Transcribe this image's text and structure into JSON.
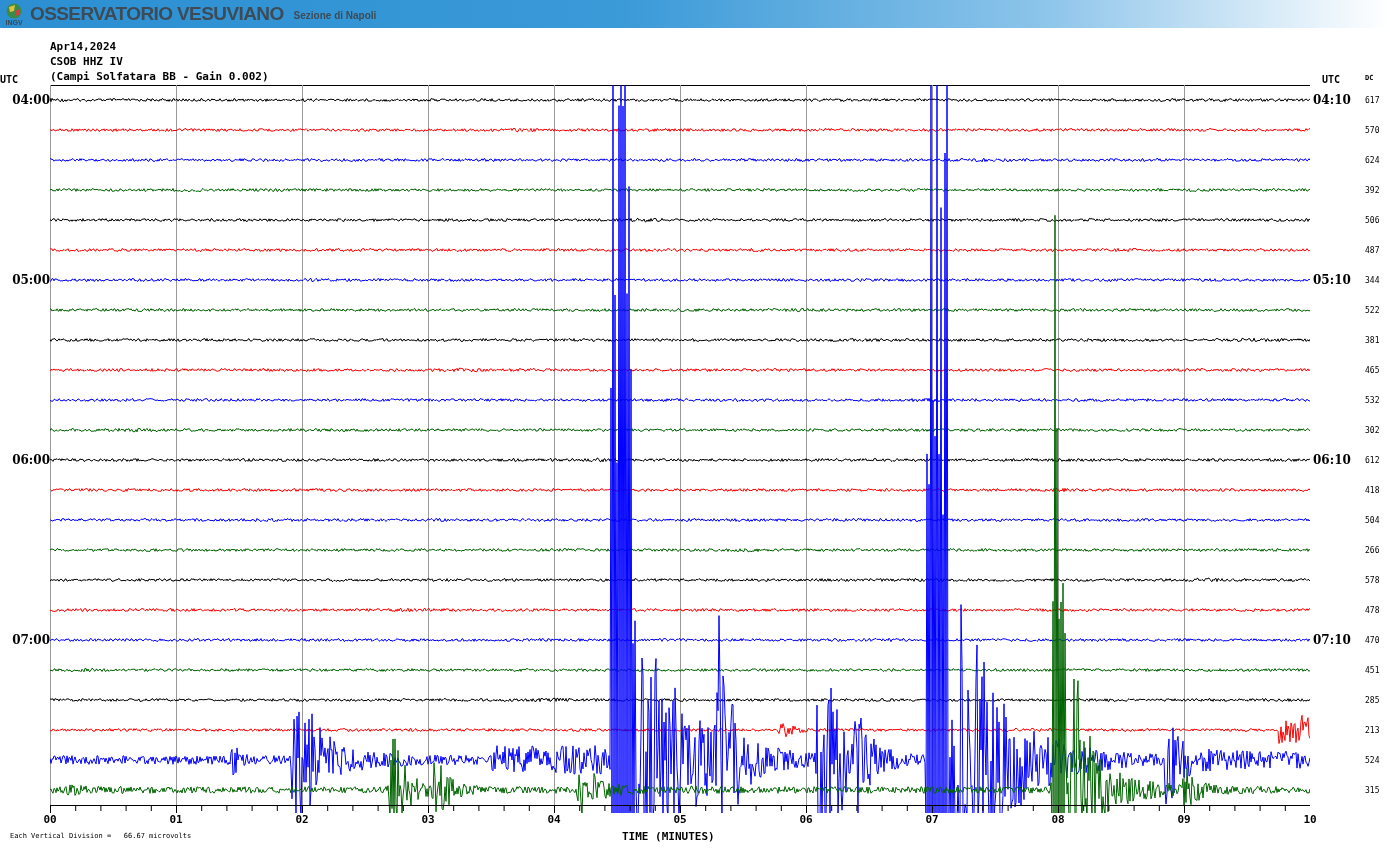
{
  "header": {
    "logo_text": "INGV",
    "title": "OSSERVATORIO VESUVIANO",
    "subtitle": "Sezione di Napoli"
  },
  "info": [
    "Apr14,2024",
    "CSOB HHZ IV",
    "(Campi Solfatara BB - Gain 0.002)"
  ],
  "left_header": "UTC",
  "right_header": "UTC",
  "dc_header": "DC",
  "traces": [
    {
      "color": "#000000",
      "left_time": "04:00",
      "right_time": "04:10",
      "dc": "617"
    },
    {
      "color": "#ff0000",
      "dc": "570"
    },
    {
      "color": "#0000ff",
      "dc": "624"
    },
    {
      "color": "#006400",
      "dc": "392"
    },
    {
      "color": "#000000",
      "dc": "506"
    },
    {
      "color": "#ff0000",
      "dc": "487"
    },
    {
      "color": "#0000ff",
      "left_time": "05:00",
      "right_time": "05:10",
      "dc": "344"
    },
    {
      "color": "#006400",
      "dc": "522"
    },
    {
      "color": "#000000",
      "dc": "381"
    },
    {
      "color": "#ff0000",
      "dc": "465"
    },
    {
      "color": "#0000ff",
      "dc": "532"
    },
    {
      "color": "#006400",
      "dc": "302"
    },
    {
      "color": "#000000",
      "left_time": "06:00",
      "right_time": "06:10",
      "dc": "612"
    },
    {
      "color": "#ff0000",
      "dc": "418"
    },
    {
      "color": "#0000ff",
      "dc": "504"
    },
    {
      "color": "#006400",
      "dc": "266"
    },
    {
      "color": "#000000",
      "dc": "578"
    },
    {
      "color": "#ff0000",
      "dc": "478"
    },
    {
      "color": "#0000ff",
      "left_time": "07:00",
      "right_time": "07:10",
      "dc": "470"
    },
    {
      "color": "#006400",
      "dc": "451"
    },
    {
      "color": "#000000",
      "dc": "285"
    },
    {
      "color": "#ff0000",
      "dc": "213"
    },
    {
      "color": "#0000ff",
      "dc": "524"
    },
    {
      "color": "#006400",
      "dc": "315"
    }
  ],
  "x_axis": {
    "labels": [
      "00",
      "01",
      "02",
      "03",
      "04",
      "05",
      "06",
      "07",
      "08",
      "09",
      "10"
    ],
    "title": "TIME (MINUTES)"
  },
  "scale_note": "Each Vertical Division =   66.67 microvolts"
}
